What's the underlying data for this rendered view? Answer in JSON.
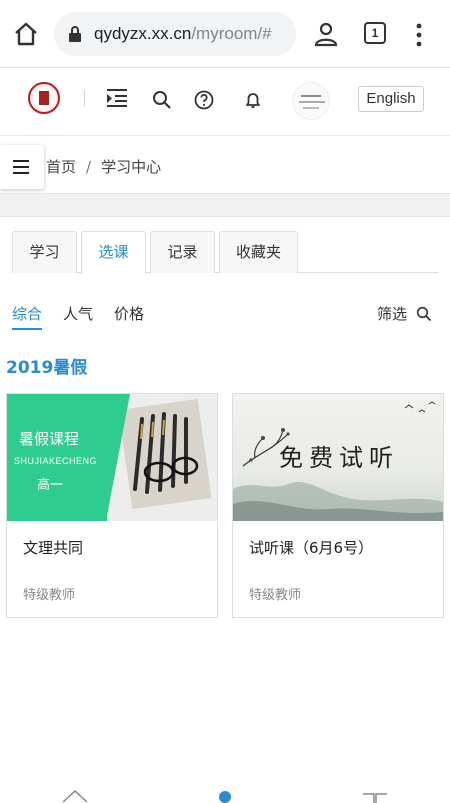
{
  "browser": {
    "url_host": "qydyzx.xx.cn",
    "url_path": "/myroom/#",
    "tab_count": "1"
  },
  "header": {
    "language_button": "English"
  },
  "breadcrumb": {
    "home": "首页",
    "separator": "/",
    "current": "学习中心"
  },
  "tabs": [
    {
      "label": "学习",
      "active": false
    },
    {
      "label": "选课",
      "active": true
    },
    {
      "label": "记录",
      "active": false
    },
    {
      "label": "收藏夹",
      "active": false
    }
  ],
  "sort": {
    "items": [
      "综合",
      "人气",
      "价格"
    ],
    "active": "综合",
    "filter_label": "筛选"
  },
  "section": {
    "title": "2019暑假"
  },
  "courses": [
    {
      "thumb_title": "暑假课程",
      "thumb_subtitle": "SHUJIAKECHENG",
      "thumb_grade": "高一",
      "title": "文理共同",
      "teacher": "特级教师"
    },
    {
      "thumb_text": "免费试听",
      "title": "试听课（6月6号）",
      "teacher": "特级教师"
    }
  ],
  "colors": {
    "accent": "#2a8bd0",
    "thumb_green": "#2ecc8f"
  }
}
